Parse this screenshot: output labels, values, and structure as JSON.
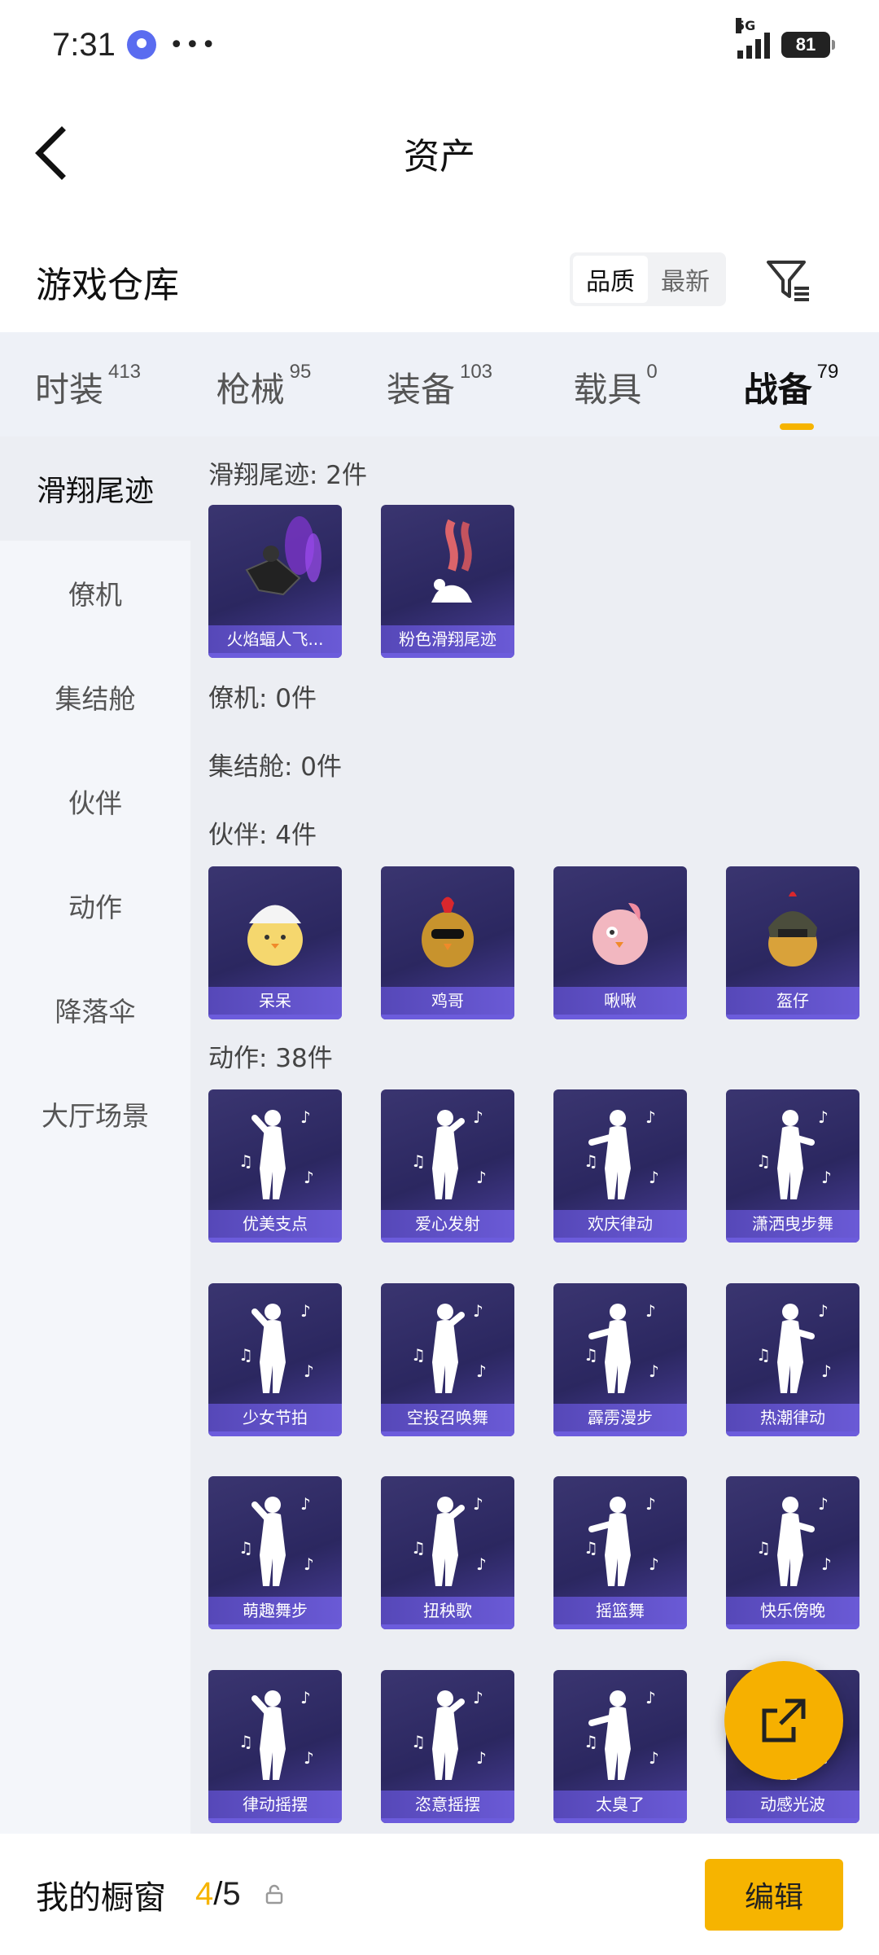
{
  "status_bar": {
    "time": "7:31",
    "network": "5G",
    "battery": "81"
  },
  "header": {
    "title": "资产"
  },
  "warehouse": {
    "title": "游戏仓库",
    "sort_options": [
      "品质",
      "最新"
    ],
    "active_sort": "品质"
  },
  "tabs": [
    {
      "label": "时装",
      "count": "413"
    },
    {
      "label": "枪械",
      "count": "95"
    },
    {
      "label": "装备",
      "count": "103"
    },
    {
      "label": "载具",
      "count": "0"
    },
    {
      "label": "战备",
      "count": "79"
    }
  ],
  "active_tab": "战备",
  "side_nav": [
    "滑翔尾迹",
    "僚机",
    "集结舱",
    "伙伴",
    "动作",
    "降落伞",
    "大厅场景"
  ],
  "active_side_item": "滑翔尾迹",
  "sections": {
    "glide_trails": {
      "title": "滑翔尾迹: 2件",
      "items": [
        "火焰蝠人飞...",
        "粉色滑翔尾迹"
      ]
    },
    "wingman": {
      "title": "僚机: 0件"
    },
    "assembly_pod": {
      "title": "集结舱: 0件"
    },
    "partners": {
      "title": "伙伴: 4件",
      "items": [
        "呆呆",
        "鸡哥",
        "啾啾",
        "盔仔"
      ]
    },
    "emotes": {
      "title": "动作: 38件",
      "items": [
        "优美支点",
        "爱心发射",
        "欢庆律动",
        "潇洒曳步舞",
        "少女节拍",
        "空投召唤舞",
        "霹雳漫步",
        "热潮律动",
        "萌趣舞步",
        "扭秧歌",
        "摇篮舞",
        "快乐傍晚",
        "律动摇摆",
        "恣意摇摆",
        "太臭了",
        "动感光波"
      ]
    }
  },
  "showcase": {
    "label": "我的橱窗",
    "current": "4",
    "separator": "/",
    "total": "5",
    "edit_label": "编辑"
  },
  "colors": {
    "accent": "#f6b400",
    "card": "#2b2760",
    "card_band": "#6a5ad6"
  }
}
